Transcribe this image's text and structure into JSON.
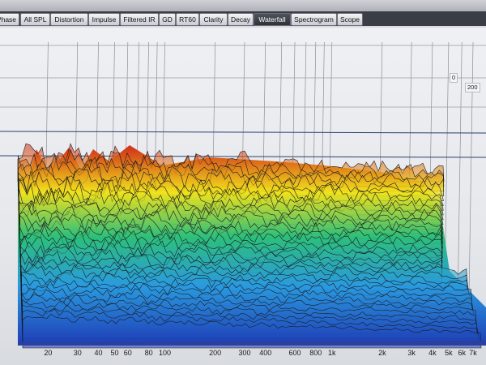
{
  "tabs": [
    {
      "label": "Phase",
      "active": false
    },
    {
      "label": "All SPL",
      "active": false
    },
    {
      "label": "Distortion",
      "active": false
    },
    {
      "label": "Impulse",
      "active": false
    },
    {
      "label": "Filtered IR",
      "active": false
    },
    {
      "label": "GD",
      "active": false
    },
    {
      "label": "RT60",
      "active": false
    },
    {
      "label": "Clarity",
      "active": false
    },
    {
      "label": "Decay",
      "active": false
    },
    {
      "label": "Waterfall",
      "active": true
    },
    {
      "label": "Spectrogram",
      "active": false
    },
    {
      "label": "Scope",
      "active": false
    }
  ],
  "time_axis": {
    "labels": [
      "0",
      "200"
    ]
  },
  "chart_data": {
    "type": "area",
    "xscale": "log",
    "xlim": [
      18,
      8000
    ],
    "xticklabels": [
      "20",
      "30",
      "40",
      "50",
      "60",
      "80",
      "100",
      "200",
      "300",
      "400",
      "600",
      "800",
      "1k",
      "2k",
      "3k",
      "4k",
      "5k",
      "6k",
      "7k"
    ],
    "colors": {
      "high": "#d43a1a",
      "mid": "#f2e21b",
      "low_mid": "#2cc07a",
      "low": "#2a9be0",
      "floor": "#1f3fb8"
    }
  }
}
